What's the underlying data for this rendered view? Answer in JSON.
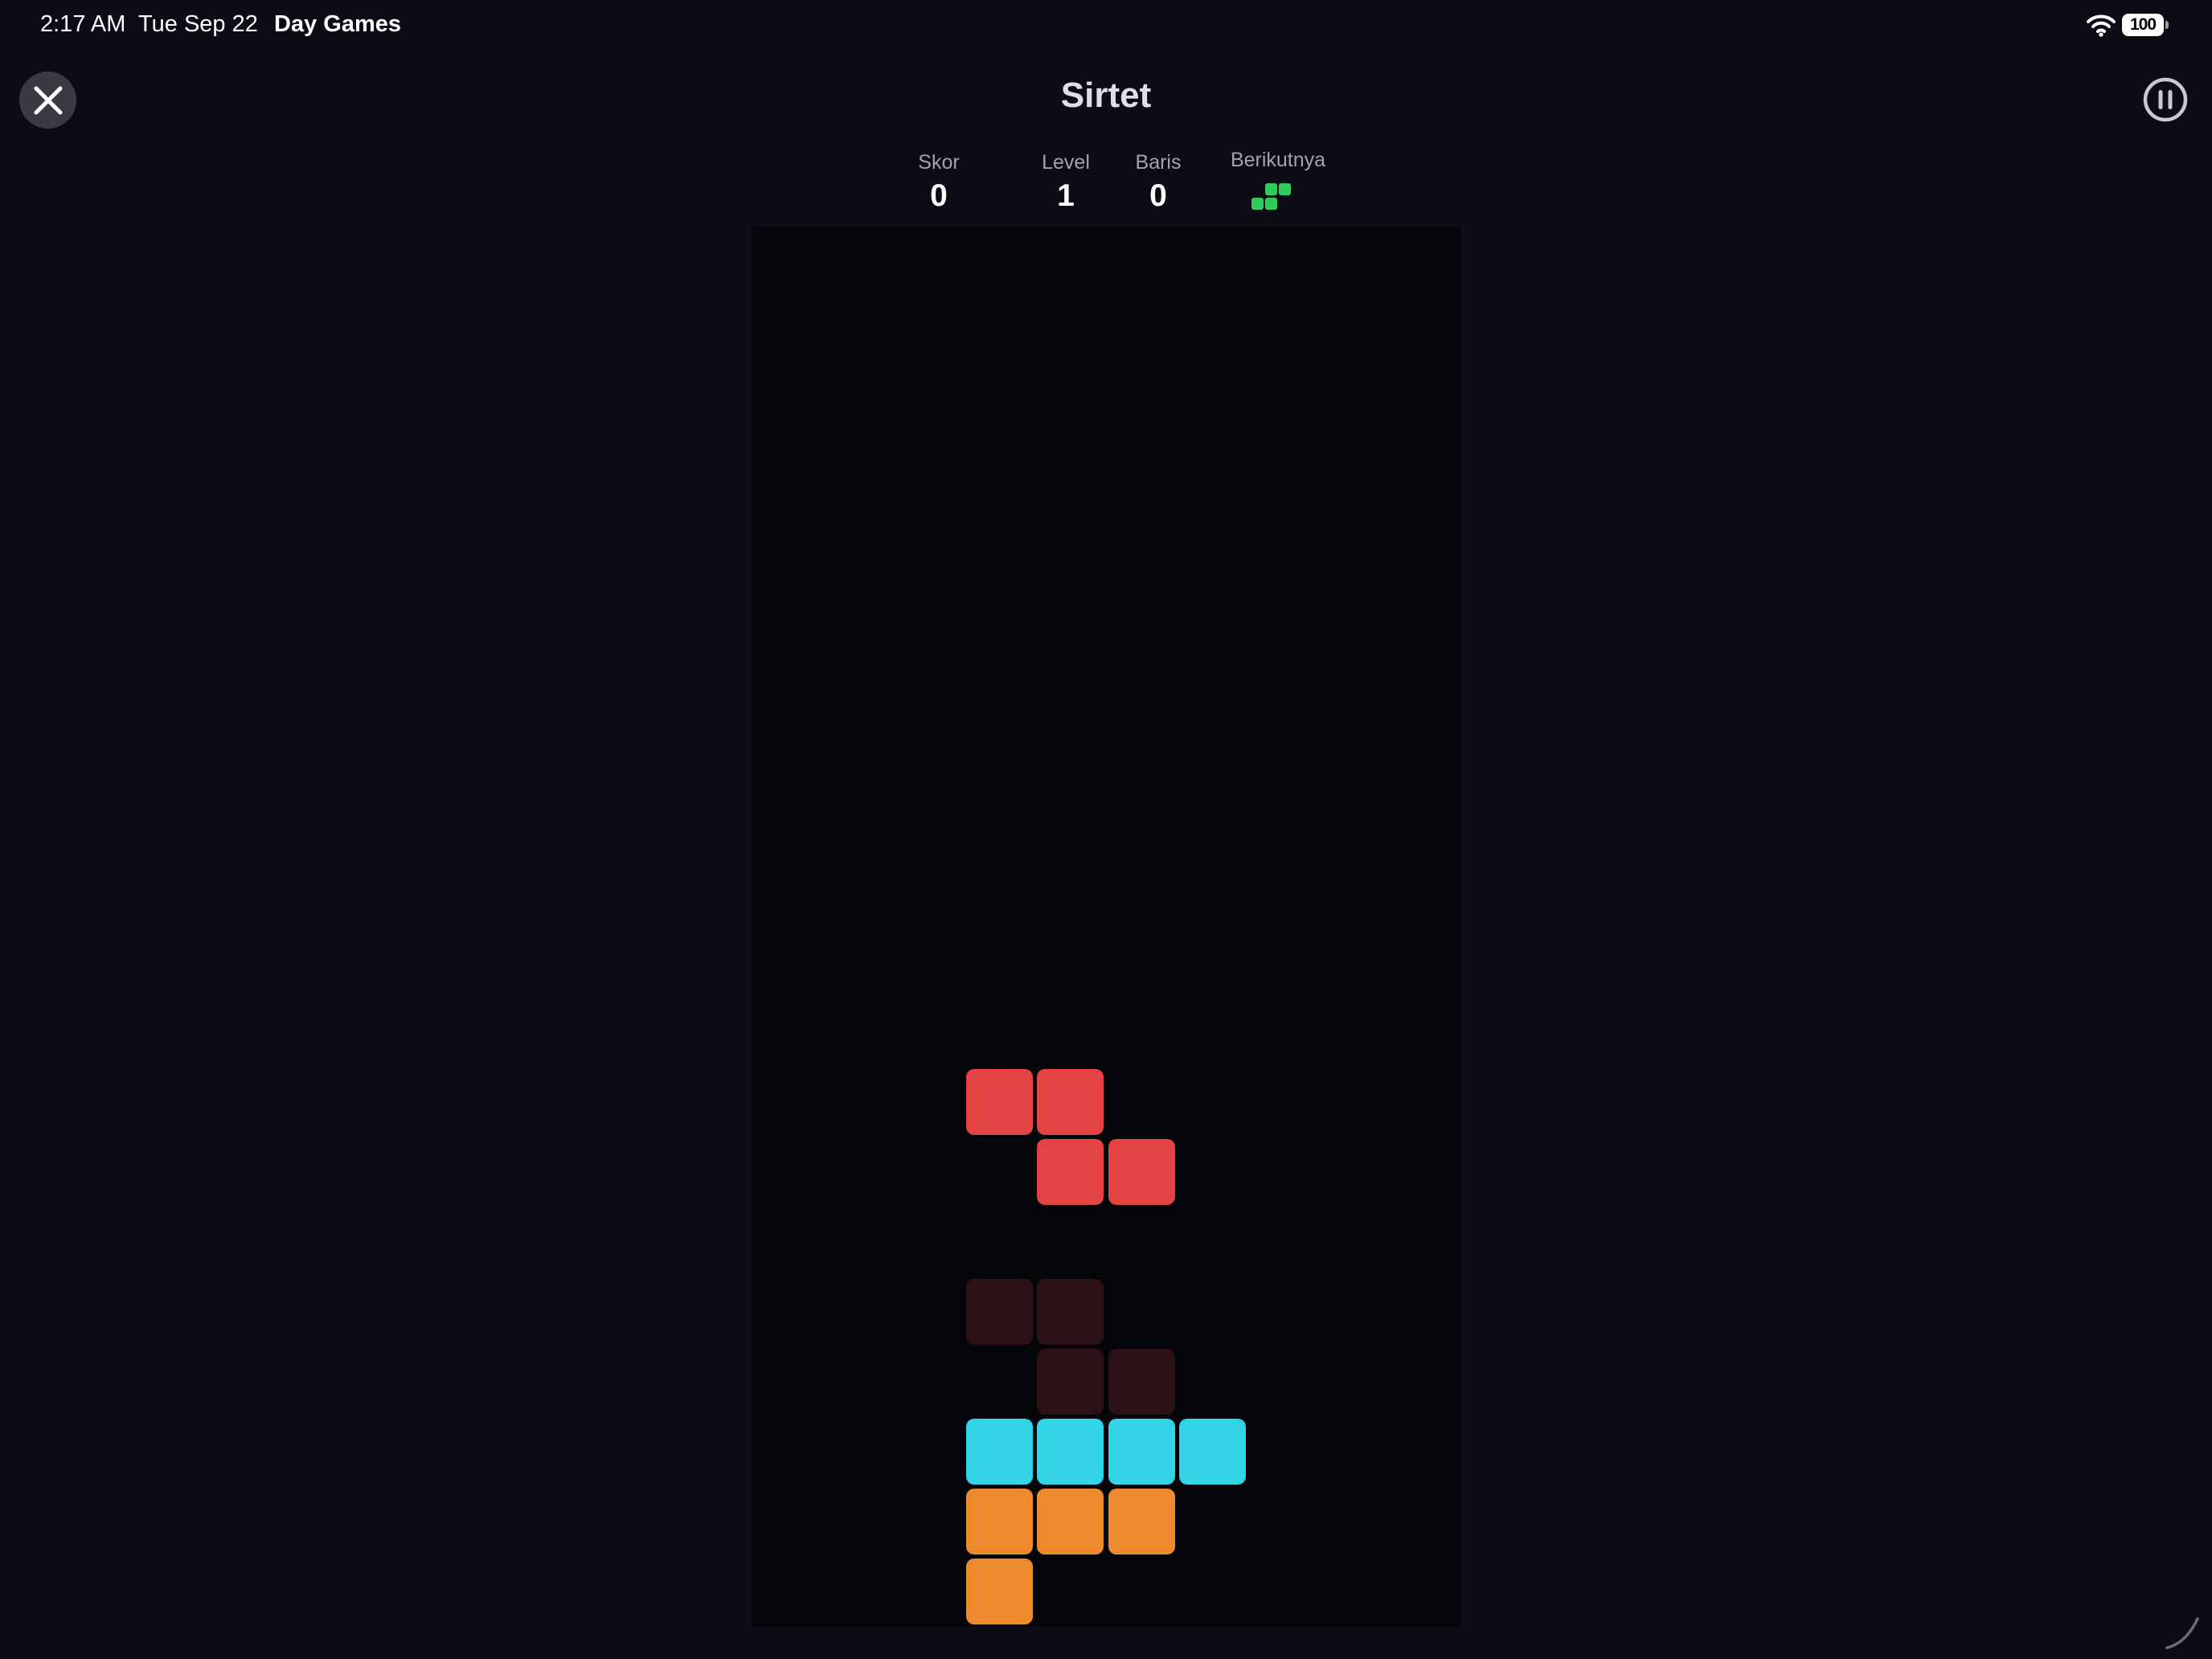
{
  "status_bar": {
    "time": "2:17 AM",
    "date": "Tue Sep 22",
    "app_name": "Day Games",
    "battery": "100"
  },
  "header": {
    "title": "Sirtet",
    "close_icon": "close-icon",
    "pause_icon": "pause-icon"
  },
  "stats": {
    "score_label": "Skor",
    "score_value": "0",
    "level_label": "Level",
    "level_value": "1",
    "lines_label": "Baris",
    "lines_value": "0",
    "next_label": "Berikutnya",
    "next_piece": {
      "type": "S",
      "color": "#2ecc5a"
    }
  },
  "board": {
    "columns": 10,
    "rows": 20,
    "background": "#040508",
    "active_piece": {
      "type": "Z",
      "color": "#e34343",
      "cells": [
        [
          3,
          12
        ],
        [
          4,
          12
        ],
        [
          4,
          13
        ],
        [
          5,
          13
        ]
      ]
    },
    "ghost_piece": {
      "type": "Z",
      "color": "#2b1015",
      "cells": [
        [
          3,
          15
        ],
        [
          4,
          15
        ],
        [
          4,
          16
        ],
        [
          5,
          16
        ]
      ]
    },
    "locked_pieces": [
      {
        "type": "I",
        "color": "#33d3e6",
        "cells": [
          [
            3,
            17
          ],
          [
            4,
            17
          ],
          [
            5,
            17
          ],
          [
            6,
            17
          ]
        ]
      },
      {
        "type": "L",
        "color": "#ed8a30",
        "cells": [
          [
            3,
            18
          ],
          [
            4,
            18
          ],
          [
            5,
            18
          ],
          [
            3,
            19
          ]
        ]
      }
    ]
  }
}
